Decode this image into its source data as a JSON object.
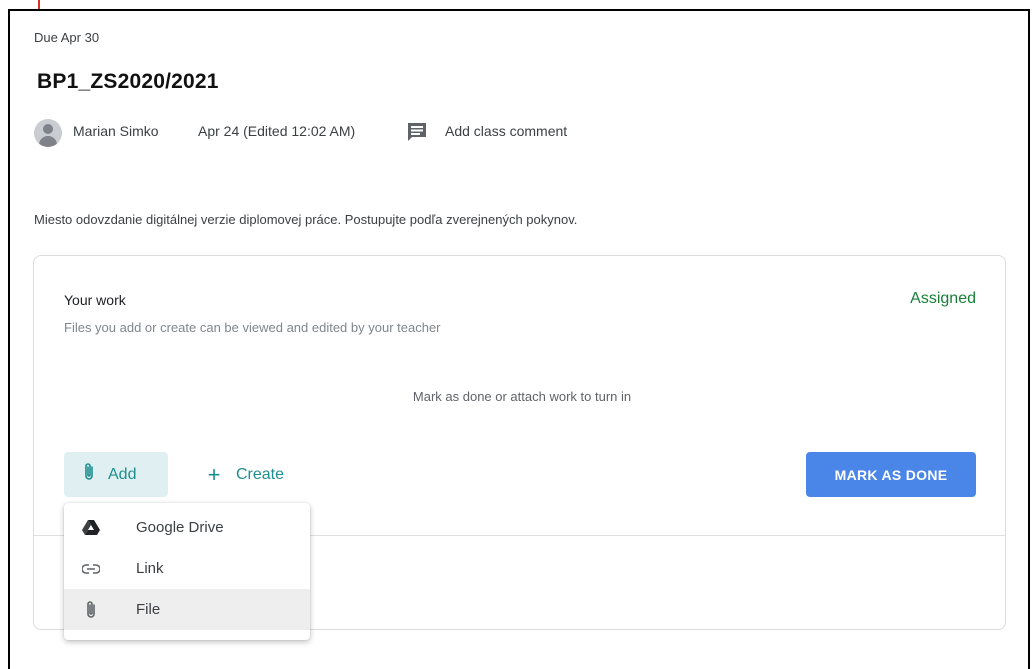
{
  "assignment": {
    "due": "Due Apr 30",
    "title": "BP1_ZS2020/2021",
    "author": "Marian Simko",
    "date": "Apr 24 (Edited 12:02 AM)",
    "comment_label": "Add class comment",
    "description": "Miesto odovzdanie digitálnej verzie diplomovej práce. Postupujte podľa zverejnených pokynov."
  },
  "your_work": {
    "heading": "Your work",
    "status": "Assigned",
    "note": "Files you add or create can be viewed and edited by your teacher",
    "empty_message": "Mark as done or attach work to turn in",
    "add_label": "Add",
    "create_label": "Create",
    "mark_done_label": "MARK AS DONE"
  },
  "add_menu": {
    "items": [
      {
        "label": "Google Drive",
        "icon": "google-drive-icon"
      },
      {
        "label": "Link",
        "icon": "link-icon"
      },
      {
        "label": "File",
        "icon": "paperclip-icon"
      }
    ],
    "highlighted_index": 2
  },
  "colors": {
    "accent_teal": "#1e8e8e",
    "status_green": "#188038",
    "primary_blue": "#4a86e8"
  }
}
